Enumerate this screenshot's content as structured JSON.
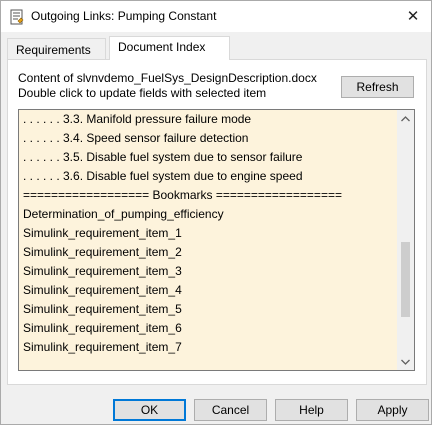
{
  "window": {
    "title": "Outgoing Links: Pumping Constant",
    "close_glyph": "✕"
  },
  "tabs": [
    {
      "label": "Requirements",
      "active": false
    },
    {
      "label": "Document Index",
      "active": true
    }
  ],
  "info": {
    "line1": "Content of slvnvdemo_FuelSys_DesignDescription.docx",
    "line2": "Double click to update fields with selected item"
  },
  "refresh_label": "Refresh",
  "list": {
    "items": [
      ". . . . . . 3.3. Manifold pressure failure mode",
      ". . . . . . 3.4. Speed sensor failure detection",
      ". . . . . . 3.5. Disable fuel system due to sensor failure",
      ". . . . . . 3.6. Disable fuel system due to engine speed",
      "================== Bookmarks ==================",
      "Determination_of_pumping_efficiency",
      "Simulink_requirement_item_1",
      "Simulink_requirement_item_2",
      "Simulink_requirement_item_3",
      "Simulink_requirement_item_4",
      "Simulink_requirement_item_5",
      "Simulink_requirement_item_6",
      "Simulink_requirement_item_7"
    ],
    "background_color": "#fdf3dc",
    "scroll_position": 0.76,
    "visible_fraction": 0.33
  },
  "buttons": {
    "ok": "OK",
    "cancel": "Cancel",
    "help": "Help",
    "apply": "Apply"
  },
  "icons": {
    "app": "document-link-icon",
    "close": "close-icon",
    "scroll_up": "chevron-up-icon",
    "scroll_down": "chevron-down-icon"
  }
}
